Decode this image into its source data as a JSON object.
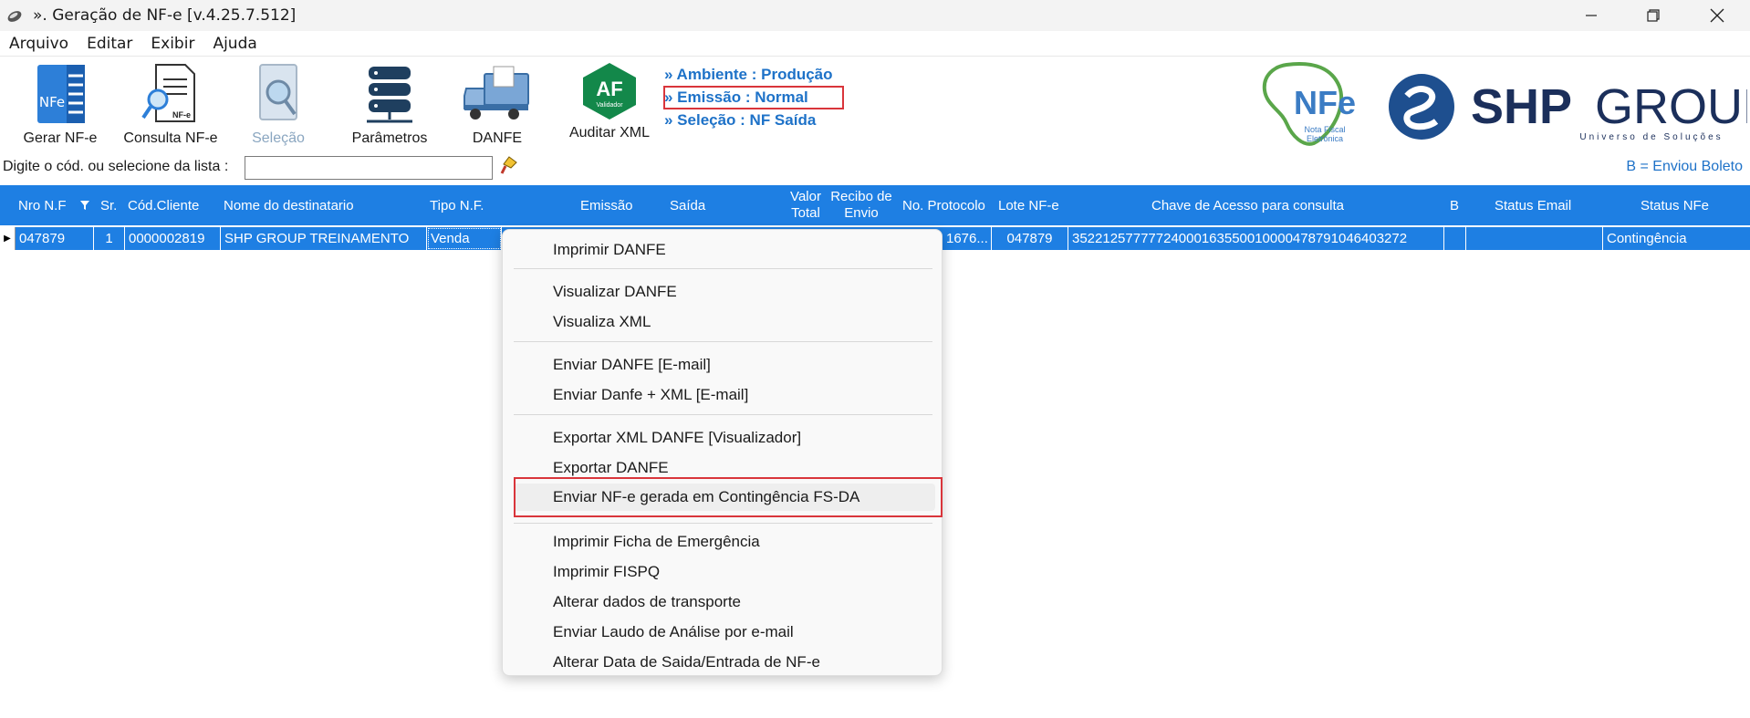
{
  "window": {
    "title": "». Geração de NF-e [v.4.25.7.512]",
    "controls": [
      "minimize-icon",
      "maximize-icon",
      "close-icon"
    ]
  },
  "menu": [
    "Arquivo",
    "Editar",
    "Exibir",
    "Ajuda"
  ],
  "toolbar": {
    "gerar": "Gerar NF-e",
    "consulta": "Consulta NF-e",
    "selecao": "Seleção",
    "parametros": "Parâmetros",
    "danfe": "DANFE",
    "auditar": "Auditar XML",
    "nfe_icon_text": "NFe",
    "consulta_icon_text": "NF-e",
    "auditar_icon_text": "AF",
    "auditar_icon_sub": "Validador"
  },
  "environment": {
    "ambiente": "» Ambiente : Produção",
    "emissao": "» Emissão    : Normal",
    "selecao": "» Seleção    : NF Saída"
  },
  "logos": {
    "nfe_text": "NFe",
    "nfe_sub1": "Nota Fiscal",
    "nfe_sub2": "Eletrônica",
    "shp_text": "SHP",
    "group_text": "GROUP",
    "group_tagline": "Universo de Soluções"
  },
  "search": {
    "label": "Digite o cód. ou selecione da lista :",
    "value": "",
    "legend": "B = Enviou Boleto"
  },
  "grid": {
    "headers": {
      "nro_nf": "Nro N.F",
      "sr": "Sr.",
      "cod_cliente": "Cód.Cliente",
      "nome": "Nome do destinatario",
      "tipo": "Tipo N.F.",
      "emissao": "Emissão",
      "saida": "Saída",
      "valor_1": "Valor",
      "valor_2": "Total",
      "recibo_1": "Recibo de",
      "recibo_2": "Envio",
      "protocolo": "No. Protocolo",
      "lote": "Lote NF-e",
      "chave": "Chave de Acesso para consulta",
      "b": "B",
      "status_email": "Status Email",
      "status_nfe": "Status NFe"
    },
    "row": {
      "nro_nf": "047879",
      "sr": "1",
      "cod_cliente": "0000002819",
      "nome": "SHP GROUP TREINAMENTO",
      "tipo": "Venda",
      "protocolo": "1676...",
      "lote": "047879",
      "chave": "35221257777724000163550010000478791046403272",
      "b": "",
      "status_email": "",
      "status_nfe": "Contingência"
    }
  },
  "context_menu": {
    "imprimir_danfe": "Imprimir DANFE",
    "visualizar_danfe": "Visualizar DANFE",
    "visualiza_xml": "Visualiza XML",
    "enviar_danfe_email": "Enviar DANFE [E-mail]",
    "enviar_danfe_xml_email": "Enviar Danfe + XML [E-mail]",
    "exportar_xml_danfe": "Exportar XML DANFE [Visualizador]",
    "exportar_danfe": "Exportar DANFE",
    "enviar_contingencia": "Enviar NF-e gerada em Contingência FS-DA",
    "imprimir_ficha": "Imprimir Ficha de Emergência",
    "imprimir_fispq": "Imprimir FISPQ",
    "alterar_transporte": "Alterar dados de transporte",
    "enviar_laudo": "Enviar Laudo de Análise por e-mail",
    "alterar_data": "Alterar Data de Saida/Entrada de NF-e"
  },
  "colors": {
    "grid_blue": "#1e7fe3",
    "env_blue": "#1e72c8",
    "highlight_red": "#d9353b"
  }
}
